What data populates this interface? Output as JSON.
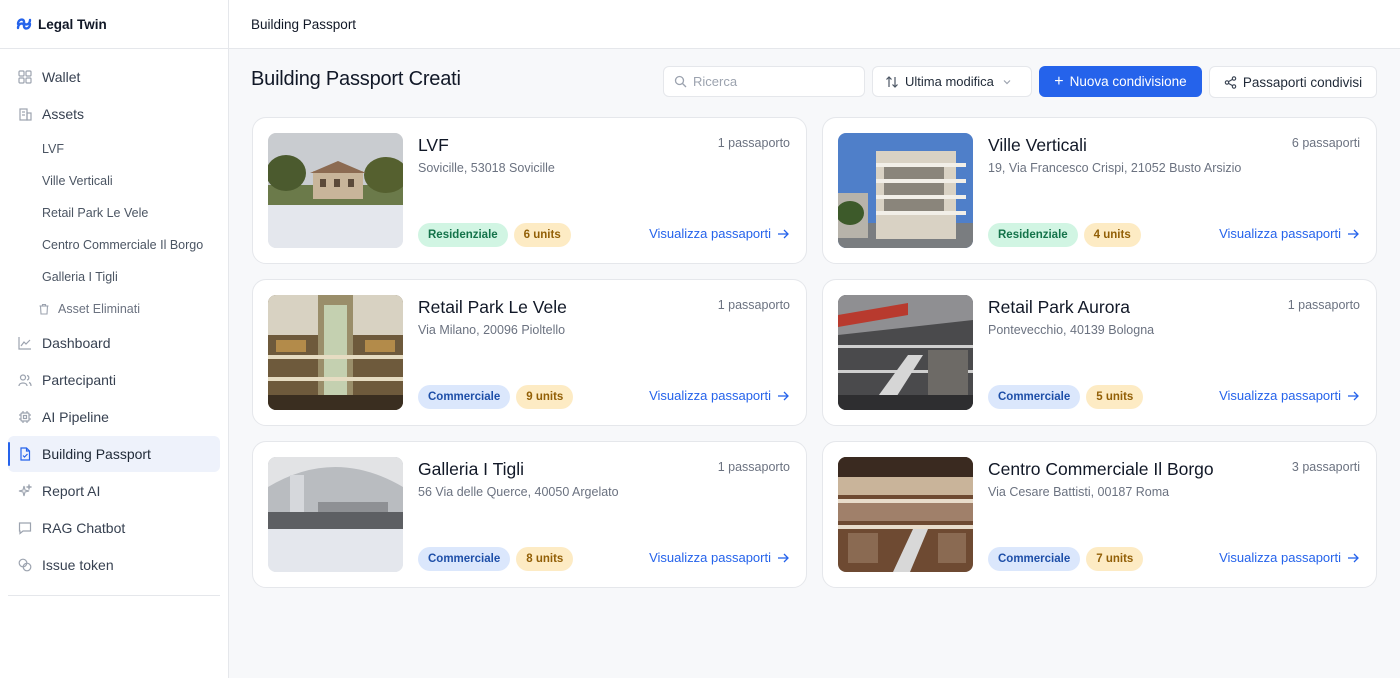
{
  "brand": {
    "name": "Legal Twin",
    "accent": "#2563eb"
  },
  "sidebar": {
    "items": [
      {
        "label": "Wallet",
        "icon": "wallet-grid-icon"
      },
      {
        "label": "Assets",
        "icon": "building-icon"
      },
      {
        "label": "Dashboard",
        "icon": "chart-line-icon"
      },
      {
        "label": "Partecipanti",
        "icon": "users-icon"
      },
      {
        "label": "AI Pipeline",
        "icon": "cpu-icon"
      },
      {
        "label": "Building Passport",
        "icon": "document-icon",
        "active": true
      },
      {
        "label": "Report AI",
        "icon": "sparkles-icon"
      },
      {
        "label": "RAG Chatbot",
        "icon": "chat-icon"
      },
      {
        "label": "Issue token",
        "icon": "coins-icon"
      }
    ],
    "assets": [
      "LVF",
      "Ville Verticali",
      "Retail Park Le Vele",
      "Centro Commerciale Il Borgo",
      "Galleria I Tigli"
    ],
    "deleted_label": "Asset Eliminati"
  },
  "topbar": {
    "title": "Building Passport"
  },
  "main": {
    "title": "Building Passport Creati",
    "search": {
      "placeholder": "Ricerca",
      "value": ""
    },
    "sort": {
      "label": "Ultima modifica"
    },
    "new_button": "Nuova condivisione",
    "shared_button": "Passaporti condivisi"
  },
  "cards": [
    {
      "title": "LVF",
      "address": "Sovicille, 53018 Sovicille",
      "count": "1 passaporto",
      "type": "Residenziale",
      "units": "6 units",
      "link": "Visualizza passaporti"
    },
    {
      "title": "Ville Verticali",
      "address": "19, Via Francesco Crispi, 21052 Busto Arsizio",
      "count": "6 passaporti",
      "type": "Residenziale",
      "units": "4 units",
      "link": "Visualizza passaporti"
    },
    {
      "title": "Retail Park Le Vele",
      "address": "Via Milano, 20096 Pioltello",
      "count": "1 passaporto",
      "type": "Commerciale",
      "units": "9 units",
      "link": "Visualizza passaporti"
    },
    {
      "title": "Retail Park Aurora",
      "address": "Pontevecchio, 40139 Bologna",
      "count": "1 passaporto",
      "type": "Commerciale",
      "units": "5 units",
      "link": "Visualizza passaporti"
    },
    {
      "title": "Galleria I Tigli",
      "address": "56 Via delle Querce, 40050 Argelato",
      "count": "1 passaporto",
      "type": "Commerciale",
      "units": "8 units",
      "link": "Visualizza passaporti"
    },
    {
      "title": "Centro Commerciale Il Borgo",
      "address": "Via Cesare Battisti, 00187 Roma",
      "count": "3 passaporti",
      "type": "Commerciale",
      "units": "7 units",
      "link": "Visualizza passaporti"
    }
  ]
}
